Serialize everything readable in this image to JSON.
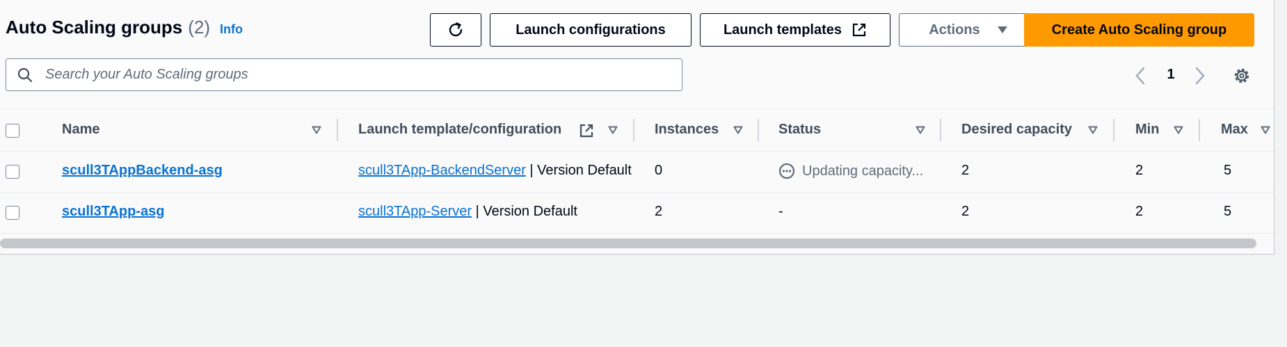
{
  "header": {
    "title": "Auto Scaling groups",
    "count": "(2)",
    "info": "Info"
  },
  "toolbar": {
    "refresh_icon": "refresh-icon",
    "launch_configurations": "Launch configurations",
    "launch_templates": "Launch templates",
    "actions": "Actions",
    "create": "Create Auto Scaling group",
    "create_color": "#ff9900"
  },
  "search": {
    "placeholder": "Search your Auto Scaling groups"
  },
  "pagination": {
    "page": "1"
  },
  "table": {
    "columns": [
      "Name",
      "Launch template/configuration",
      "Instances",
      "Status",
      "Desired capacity",
      "Min",
      "Max"
    ],
    "rows": [
      {
        "name": "scull3TAppBackend-asg",
        "template_link": "scull3TApp-BackendServer",
        "template_version": "| Version Default",
        "instances": "0",
        "status": "Updating capacity...",
        "desired": "2",
        "min": "2",
        "max": "5"
      },
      {
        "name": "scull3TApp-asg",
        "template_link": "scull3TApp-Server",
        "template_version": "| Version Default",
        "instances": "2",
        "status": "-",
        "desired": "2",
        "min": "2",
        "max": "5"
      }
    ]
  },
  "colors": {
    "link": "#0972d3",
    "primary": "#ff9900",
    "text": "#000716"
  }
}
